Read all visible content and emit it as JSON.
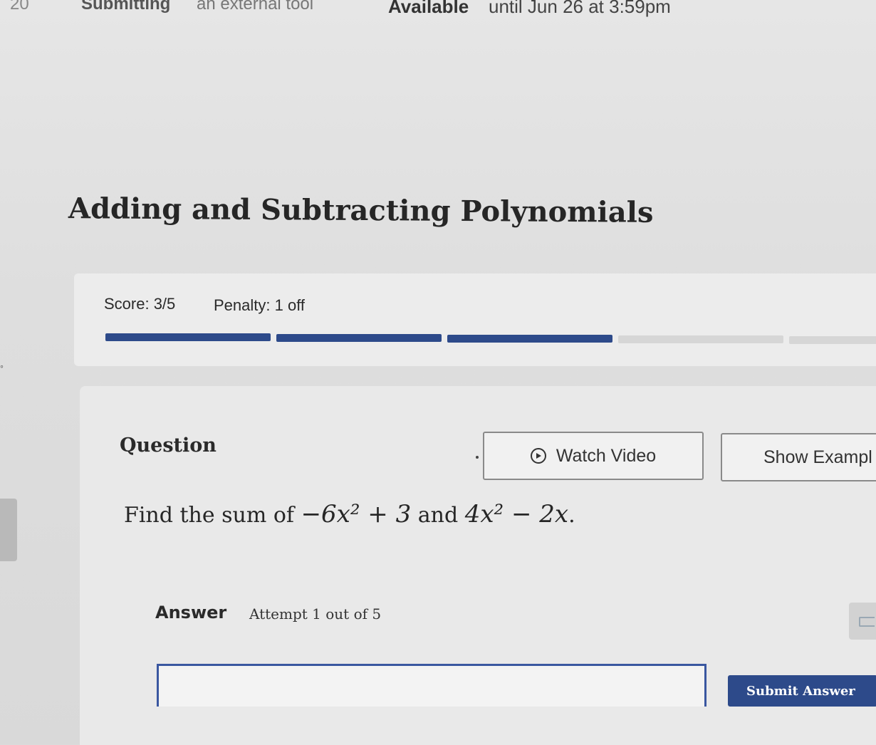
{
  "header": {
    "number_fragment": "20",
    "submitting_label": "Submitting",
    "submitting_value": "an external tool",
    "available_label": "Available",
    "available_value": "until Jun 26 at 3:59pm"
  },
  "page": {
    "title": "Adding and Subtracting Polynomials"
  },
  "score": {
    "score_text": "Score: 3/5",
    "penalty_text": "Penalty: 1 off",
    "progress": {
      "completed": 3,
      "total": 5
    },
    "colors": {
      "done": "#2d4a8a",
      "todo": "#d6d6d6"
    }
  },
  "question": {
    "label": "Question",
    "watch_video_label": "Watch Video",
    "show_example_label": "Show Exampl",
    "prompt_prefix": "Find the sum of",
    "expr1": "−6x² + 3",
    "prompt_and": "and",
    "expr2": "4x² − 2x",
    "prompt_suffix": "."
  },
  "answer": {
    "label": "Answer",
    "attempt_text": "Attempt 1 out of 5",
    "input_value": "",
    "submit_label": "Submit Answer"
  },
  "icons": {
    "watch_video": "play-circle-icon",
    "side_tab": "panel-icon"
  }
}
